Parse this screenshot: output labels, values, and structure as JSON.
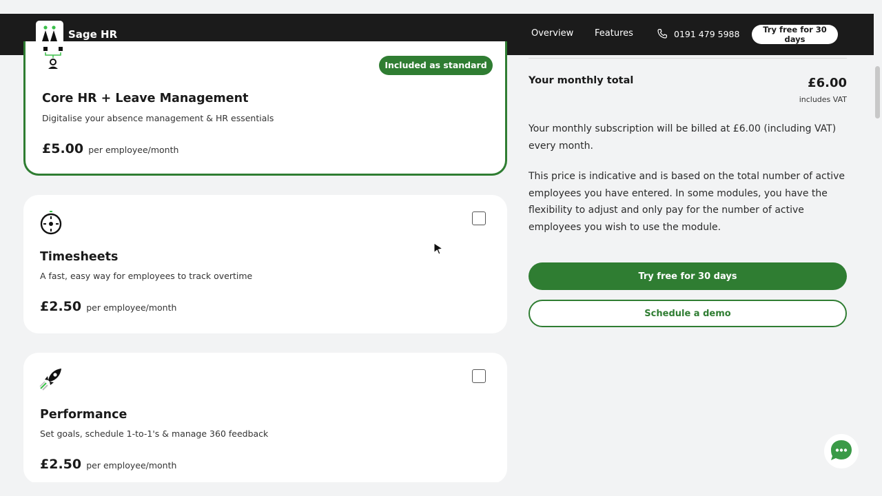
{
  "nav": {
    "brand": "Sage HR",
    "links": [
      "Overview",
      "Features"
    ],
    "phone": "0191 479 5988",
    "cta": "Try free for 30 days"
  },
  "modules": [
    {
      "title": "Core HR + Leave Management",
      "description": "Digitalise your absence management & HR essentials",
      "price": "£5.00",
      "unit": "per employee/month",
      "badge": "Included as standard",
      "icon": "people-org-icon",
      "selected": true
    },
    {
      "title": "Timesheets",
      "description": "A fast, easy way for employees to track overtime",
      "price": "£2.50",
      "unit": "per employee/month",
      "icon": "stopwatch-icon",
      "selected": false
    },
    {
      "title": "Performance",
      "description": "Set goals, schedule 1-to-1's & manage 360 feedback",
      "price": "£2.50",
      "unit": "per employee/month",
      "icon": "rocket-icon",
      "selected": false
    }
  ],
  "summary": {
    "total_label": "Your monthly total",
    "total_value": "£6.00",
    "vat_note": "includes VAT",
    "billing_text": "Your monthly subscription will be billed at £6.00 (including VAT) every month.",
    "disclaimer": "This price is indicative and is based on the total number of active employees you have entered. In some modules, you have the flexibility to adjust and only pay for the number of active employees you wish to use the module.",
    "primary_cta": "Try free for 30 days",
    "secondary_cta": "Schedule a demo"
  },
  "colors": {
    "brand_green": "#2f7d32",
    "navbar_bg": "#1b1b1b",
    "page_bg": "#f2f3f4",
    "chat_green": "#3a9a47"
  }
}
